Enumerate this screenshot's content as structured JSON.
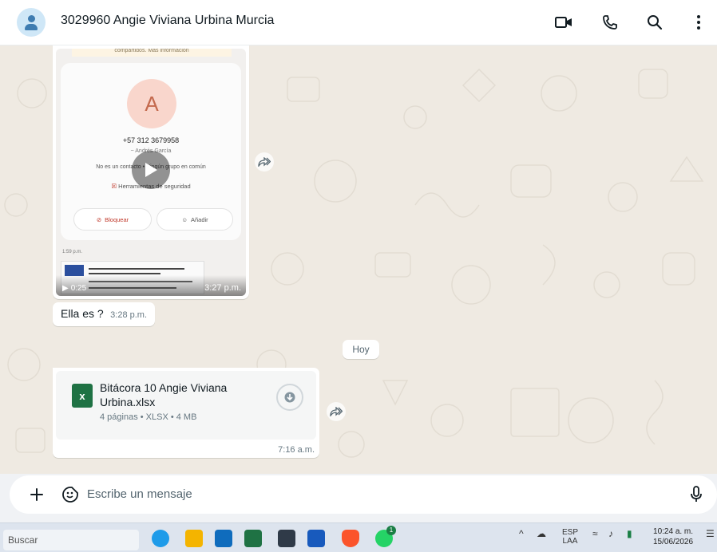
{
  "header": {
    "contact_name": "3029960 Angie Viviana Urbina Murcia",
    "icons": [
      "video-call-icon",
      "voice-call-icon",
      "search-icon",
      "more-options-icon"
    ]
  },
  "video_message": {
    "banner": "compartidos. Más información",
    "contact_initial": "A",
    "phone": "+57 312 3679958",
    "alias": "~ Andrés García",
    "note": "No es un contacto • Ningún grupo en común",
    "tools_label": "Herramientas de seguridad",
    "block_label": "Bloquear",
    "add_label": "Añadir",
    "inner_time": "1:59 p.m.",
    "duration": "0:25",
    "time": "3:27 p.m."
  },
  "text_message": {
    "text": "Ella es ?",
    "time": "3:28 p.m."
  },
  "date_divider": "Hoy",
  "document_message": {
    "file_name": "Bitácora 10 Angie Viviana Urbina.xlsx",
    "file_icon_letter": "x",
    "meta": "4 páginas • XLSX • 4 MB",
    "time": "7:16 a.m."
  },
  "composer": {
    "placeholder": "Escribe un mensaje"
  },
  "taskbar": {
    "search_placeholder": "Buscar",
    "whatsapp_badge": "1",
    "language_top": "ESP",
    "language_bottom": "LAA",
    "time": "10:24 a. m.",
    "date": "15/06/2026"
  },
  "colors": {
    "chat_background": "#efeae2",
    "header_background": "#ffffff",
    "xlsx_green": "#1f7244",
    "icon_dark": "#111b21"
  }
}
